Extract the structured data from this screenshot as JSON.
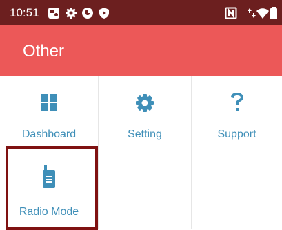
{
  "status_bar": {
    "time": "10:51",
    "left_icons": [
      "photo-app-icon",
      "settings-gear-icon",
      "vpn-status-icon",
      "shield-play-icon"
    ],
    "right_icons": [
      "nfc-icon",
      "data-arrows-icon",
      "wifi-icon",
      "battery-icon"
    ]
  },
  "header": {
    "title": "Other",
    "color": "#ec5858"
  },
  "grid": {
    "items": [
      {
        "label": "Dashboard",
        "icon": "dashboard-icon"
      },
      {
        "label": "Setting",
        "icon": "gear-icon"
      },
      {
        "label": "Support",
        "icon": "question-mark-icon"
      },
      {
        "label": "Radio Mode",
        "icon": "radio-icon"
      }
    ],
    "icon_color": "#3f8fb8",
    "selected": "Radio Mode"
  },
  "colors": {
    "status_bar": "#6c1f1f",
    "header": "#ec5858",
    "accent": "#3f8fb8",
    "selection_border": "#7f1212"
  }
}
